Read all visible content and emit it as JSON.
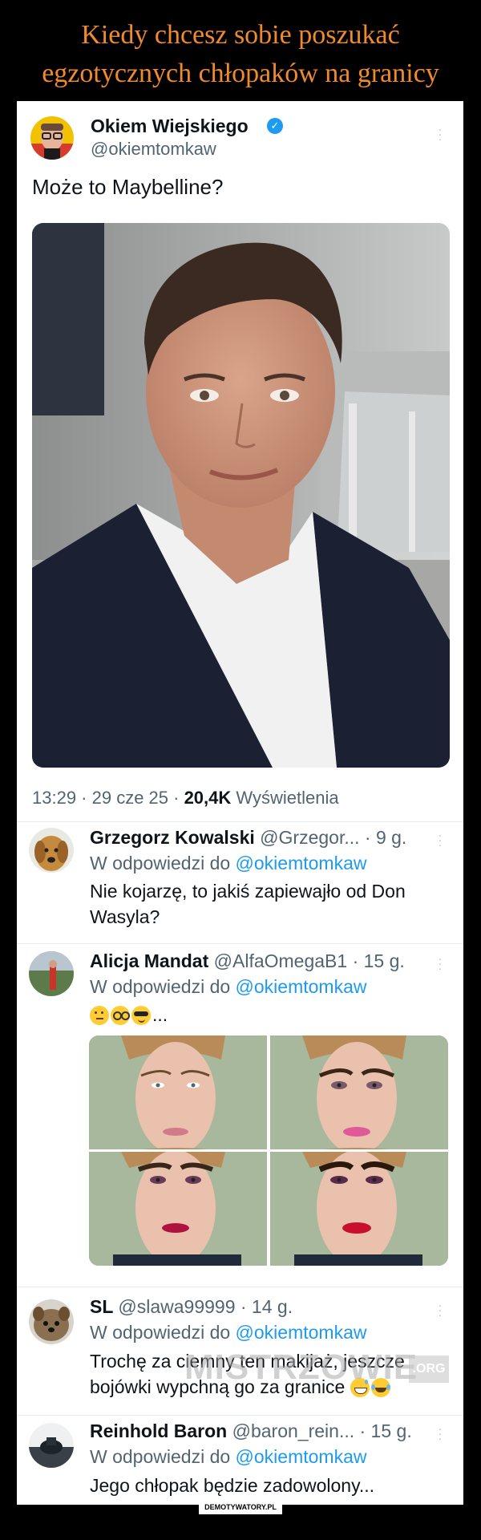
{
  "meme": {
    "title_line1": "Kiedy chcesz sobie poszukać",
    "title_line2": "egzotycznych chłopaków na granicy",
    "footer": "DEMOTYWATORY.PL",
    "watermark": "MISTRZOWIE",
    "watermark_org": ".ORG"
  },
  "tweet": {
    "author_name": "Okiem Wiejskiego",
    "author_handle": "@okiemtomkaw",
    "text": "Może to Maybelline?",
    "time": "13:29 · 29 cze 25 · ",
    "views_count": "20,4K",
    "views_label": " Wyświetlenia"
  },
  "replies": [
    {
      "name": "Grzegorz Kowalski",
      "handle": "@Grzegor... · 9 g.",
      "reply_prefix": "W odpowiedzi do ",
      "reply_to": "@okiemtomkaw",
      "text_line1": "Nie kojarzę, to jakiś zapiewajło od Don",
      "text_line2": "Wasyla?"
    },
    {
      "name": "Alicja Mandat",
      "handle": "@AlfaOmegaB1 · 15 g.",
      "reply_prefix": "W odpowiedzi do ",
      "reply_to": "@okiemtomkaw",
      "text_suffix": "..."
    },
    {
      "name": "SL",
      "handle": "@slawa99999 · 14 g.",
      "reply_prefix": "W odpowiedzi do ",
      "reply_to": "@okiemtomkaw",
      "text_line1": "Trochę za ciemny ten makijaż, jeszcze",
      "text_line2": "bojówki wypchną go za granice"
    },
    {
      "name": "Reinhold Baron",
      "handle": "@baron_rein... · 15 g.",
      "reply_prefix": "W odpowiedzi do ",
      "reply_to": "@okiemtomkaw",
      "text_line1": "Jego chłopak będzie zadowolony..."
    }
  ],
  "colors": {
    "title": "#f08a2e",
    "link": "#1d9bf0",
    "secondary": "#536471",
    "primary": "#0f1419"
  }
}
